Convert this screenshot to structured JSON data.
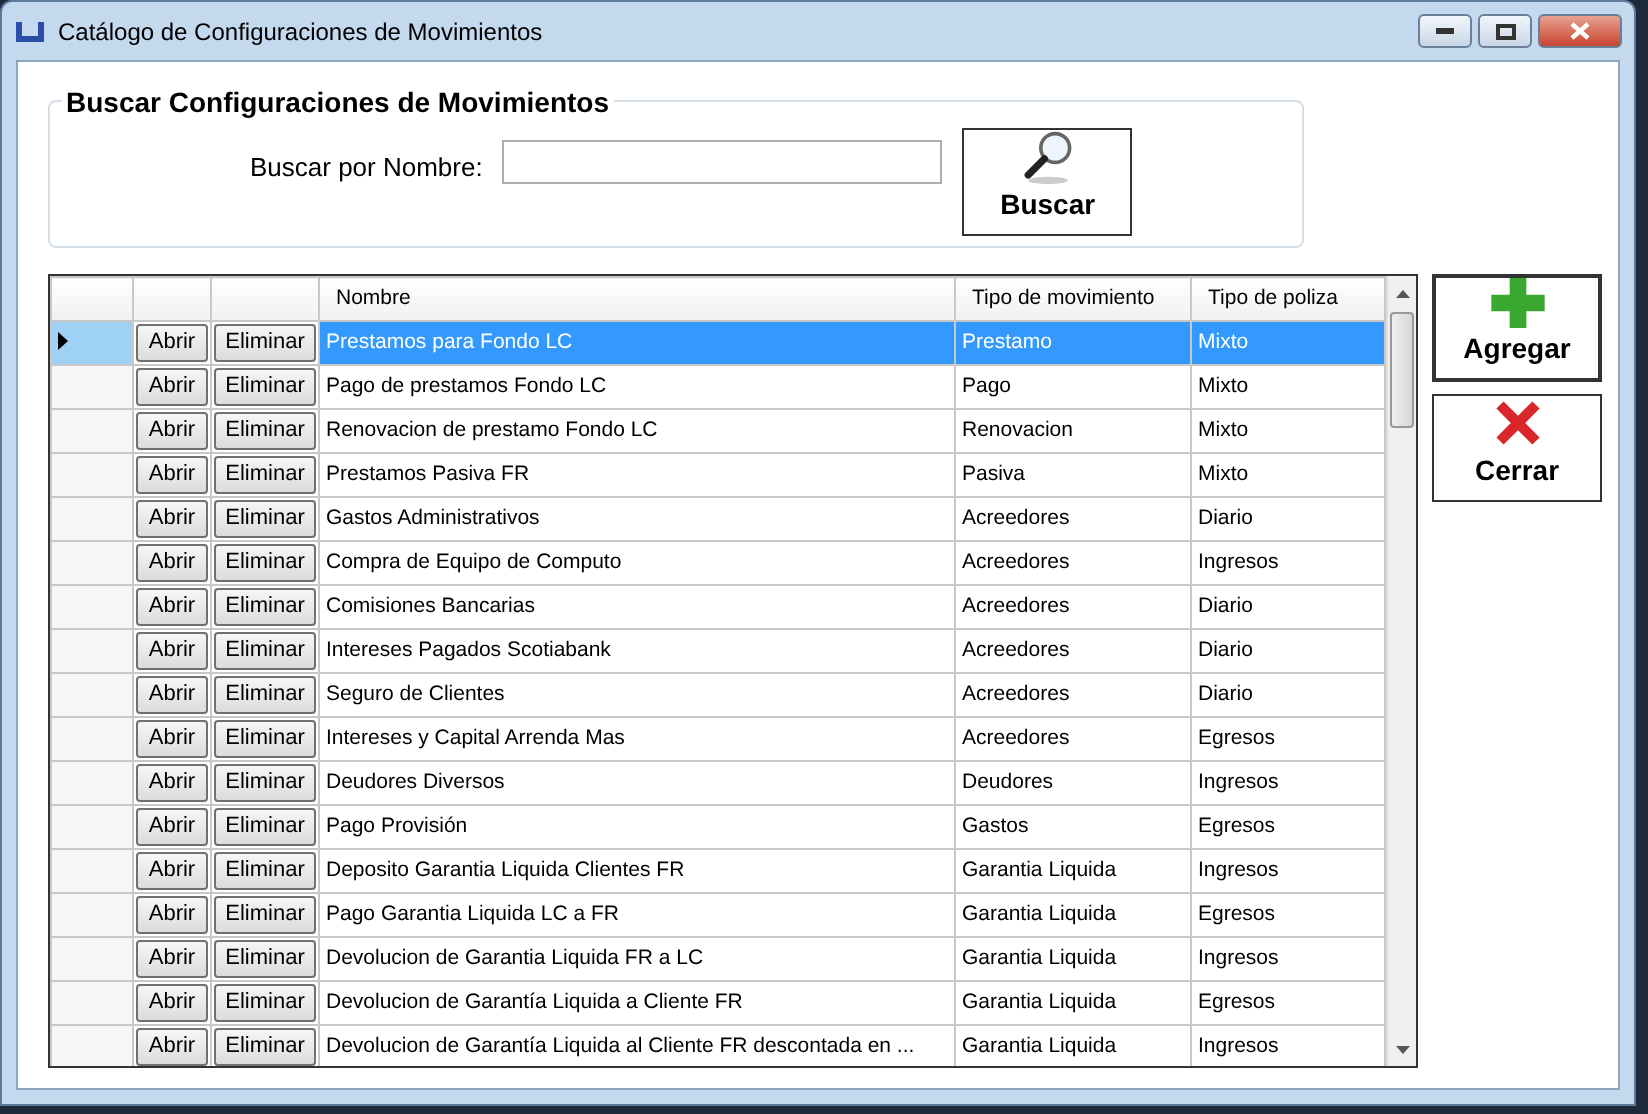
{
  "window": {
    "title": "Catálogo de Configuraciones de Movimientos"
  },
  "search": {
    "title": "Buscar Configuraciones de Movimientos",
    "label": "Buscar por Nombre:",
    "button": "Buscar"
  },
  "table": {
    "columns": [
      "",
      "",
      "Nombre",
      "Tipo de movimiento",
      "Tipo de poliza"
    ],
    "rows": [
      {
        "open": "Abrir",
        "delete": "Eliminar",
        "name": "Prestamos para Fondo LC",
        "movement_type": "Prestamo",
        "policy_type": "Mixto",
        "selected": true
      },
      {
        "open": "Abrir",
        "delete": "Eliminar",
        "name": "Pago de prestamos Fondo LC",
        "movement_type": "Pago",
        "policy_type": "Mixto",
        "selected": false
      },
      {
        "open": "Abrir",
        "delete": "Eliminar",
        "name": "Renovacion de prestamo Fondo LC",
        "movement_type": "Renovacion",
        "policy_type": "Mixto",
        "selected": false
      },
      {
        "open": "Abrir",
        "delete": "Eliminar",
        "name": "Prestamos Pasiva FR",
        "movement_type": "Pasiva",
        "policy_type": "Mixto",
        "selected": false
      },
      {
        "open": "Abrir",
        "delete": "Eliminar",
        "name": "Gastos Administrativos",
        "movement_type": "Acreedores",
        "policy_type": "Diario",
        "selected": false
      },
      {
        "open": "Abrir",
        "delete": "Eliminar",
        "name": "Compra de Equipo de Computo",
        "movement_type": "Acreedores",
        "policy_type": "Ingresos",
        "selected": false
      },
      {
        "open": "Abrir",
        "delete": "Eliminar",
        "name": "Comisiones Bancarias",
        "movement_type": "Acreedores",
        "policy_type": "Diario",
        "selected": false
      },
      {
        "open": "Abrir",
        "delete": "Eliminar",
        "name": "Intereses Pagados Scotiabank",
        "movement_type": "Acreedores",
        "policy_type": "Diario",
        "selected": false
      },
      {
        "open": "Abrir",
        "delete": "Eliminar",
        "name": "Seguro de Clientes",
        "movement_type": "Acreedores",
        "policy_type": "Diario",
        "selected": false
      },
      {
        "open": "Abrir",
        "delete": "Eliminar",
        "name": "Intereses y Capital Arrenda Mas",
        "movement_type": "Acreedores",
        "policy_type": "Egresos",
        "selected": false
      },
      {
        "open": "Abrir",
        "delete": "Eliminar",
        "name": "Deudores Diversos",
        "movement_type": "Deudores",
        "policy_type": "Ingresos",
        "selected": false
      },
      {
        "open": "Abrir",
        "delete": "Eliminar",
        "name": "Pago Provisión",
        "movement_type": "Gastos",
        "policy_type": "Egresos",
        "selected": false
      },
      {
        "open": "Abrir",
        "delete": "Eliminar",
        "name": "Deposito Garantia Liquida Clientes FR",
        "movement_type": "Garantia Liquida",
        "policy_type": "Ingresos",
        "selected": false
      },
      {
        "open": "Abrir",
        "delete": "Eliminar",
        "name": "Pago Garantia Liquida LC a FR",
        "movement_type": "Garantia Liquida",
        "policy_type": "Egresos",
        "selected": false
      },
      {
        "open": "Abrir",
        "delete": "Eliminar",
        "name": "Devolucion de Garantia Liquida FR a LC",
        "movement_type": "Garantia Liquida",
        "policy_type": "Ingresos",
        "selected": false
      },
      {
        "open": "Abrir",
        "delete": "Eliminar",
        "name": "Devolucion de Garantía Liquida a Cliente FR",
        "movement_type": "Garantia Liquida",
        "policy_type": "Egresos",
        "selected": false
      },
      {
        "open": "Abrir",
        "delete": "Eliminar",
        "name": "Devolucion de Garantía Liquida al Cliente FR descontada en ...",
        "movement_type": "Garantia Liquida",
        "policy_type": "Ingresos",
        "selected": false
      }
    ]
  },
  "actions": [
    {
      "kind": "add",
      "label": "Agregar"
    },
    {
      "kind": "close",
      "label": "Cerrar"
    }
  ]
}
